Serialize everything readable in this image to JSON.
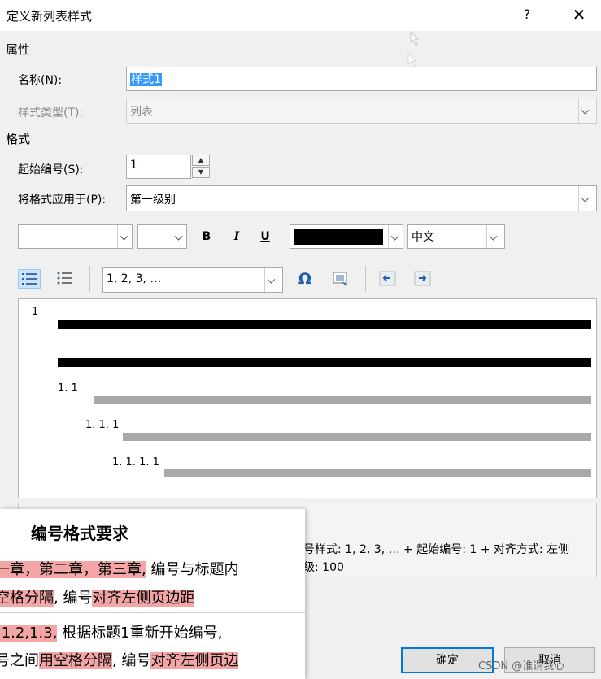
{
  "window": {
    "title": "定义新列表样式",
    "help_label": "?",
    "close_label": "✕"
  },
  "properties": {
    "section_label": "属性",
    "name_label": "名称(N):",
    "name_value": "样式1",
    "style_type_label": "样式类型(T):",
    "style_type_value": "列表"
  },
  "format": {
    "section_label": "格式",
    "start_at_label": "起始编号(S):",
    "start_at_value": "1",
    "spin_up": "▲",
    "spin_down": "▼",
    "apply_to_label": "将格式应用于(P):",
    "apply_to_value": "第一级别"
  },
  "font_toolbar": {
    "font_value": "",
    "size_value": "",
    "bold": "B",
    "italic": "I",
    "underline": "U",
    "font_color": "#000000",
    "script_value": "中文"
  },
  "numbering_toolbar": {
    "numbering_style_value": "1, 2, 3, …",
    "omega": "Ω"
  },
  "preview": {
    "levels": [
      "1",
      "1. 1",
      "1. 1. 1",
      "1. 1. 1. 1"
    ]
  },
  "description": {
    "line1": "号样式: 1, 2, 3, … + 起始编号: 1 + 对齐方式: 左侧",
    "line2": "级: 100"
  },
  "buttons": {
    "ok": "确定",
    "cancel": "取消"
  },
  "overlay": {
    "title": "编号格式要求",
    "row1": {
      "hl_a": "一章，第二章，第三章,",
      "plain_a": " 编号与标题内"
    },
    "row2": {
      "hl_a": "空格分隔",
      "plain_a": ", 编号",
      "hl_b": "对齐左侧页边距"
    },
    "row3": {
      "hl_a": ",1.2,1.3,",
      "plain_a": " 根据标题1重新开始编号,"
    },
    "row4": {
      "plain_a": "号之间",
      "hl_a": "用空格分隔",
      "plain_b": ", 编号",
      "hl_b": "对齐左侧页边"
    },
    "highlight_color": "#f4a6a6"
  },
  "watermark": "CSDN @谁谓我心"
}
